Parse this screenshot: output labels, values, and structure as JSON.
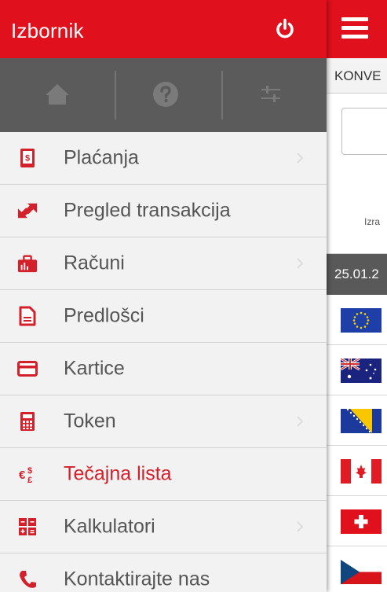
{
  "drawer": {
    "title": "Izbornik",
    "power_icon": "power-icon",
    "quick_actions": [
      {
        "name": "home",
        "icon": "home-icon"
      },
      {
        "name": "help",
        "icon": "question-icon"
      },
      {
        "name": "settings",
        "icon": "sliders-icon"
      }
    ],
    "items": [
      {
        "label": "Plaćanja",
        "icon": "payment-phone-icon",
        "has_submenu": true,
        "active": false
      },
      {
        "label": "Pregled transakcija",
        "icon": "transfer-arrows-icon",
        "has_submenu": false,
        "active": false
      },
      {
        "label": "Računi",
        "icon": "accounts-icon",
        "has_submenu": true,
        "active": false
      },
      {
        "label": "Predlošci",
        "icon": "document-icon",
        "has_submenu": false,
        "active": false
      },
      {
        "label": "Kartice",
        "icon": "card-icon",
        "has_submenu": false,
        "active": false
      },
      {
        "label": "Token",
        "icon": "calculator-token-icon",
        "has_submenu": true,
        "active": false
      },
      {
        "label": "Tečajna lista",
        "icon": "currency-icon",
        "has_submenu": false,
        "active": true
      },
      {
        "label": "Kalkulatori",
        "icon": "calculator-icon",
        "has_submenu": true,
        "active": false
      },
      {
        "label": "Kontaktirajte nas",
        "icon": "phone-icon",
        "has_submenu": false,
        "active": false
      }
    ]
  },
  "main": {
    "menu_icon": "hamburger-icon",
    "tab_title": "KONVE",
    "note": "Izra",
    "date": "25.01.2",
    "flags": [
      "eu-flag",
      "australia-flag",
      "bosnia-flag",
      "canada-flag",
      "switzerland-flag",
      "czech-flag"
    ]
  },
  "colors": {
    "brand_red": "#e0101d",
    "quickbar_gray": "#5b5b5b",
    "drawer_bg": "#f2f2f2",
    "label_gray": "#555555",
    "active_red": "#d3202a"
  }
}
